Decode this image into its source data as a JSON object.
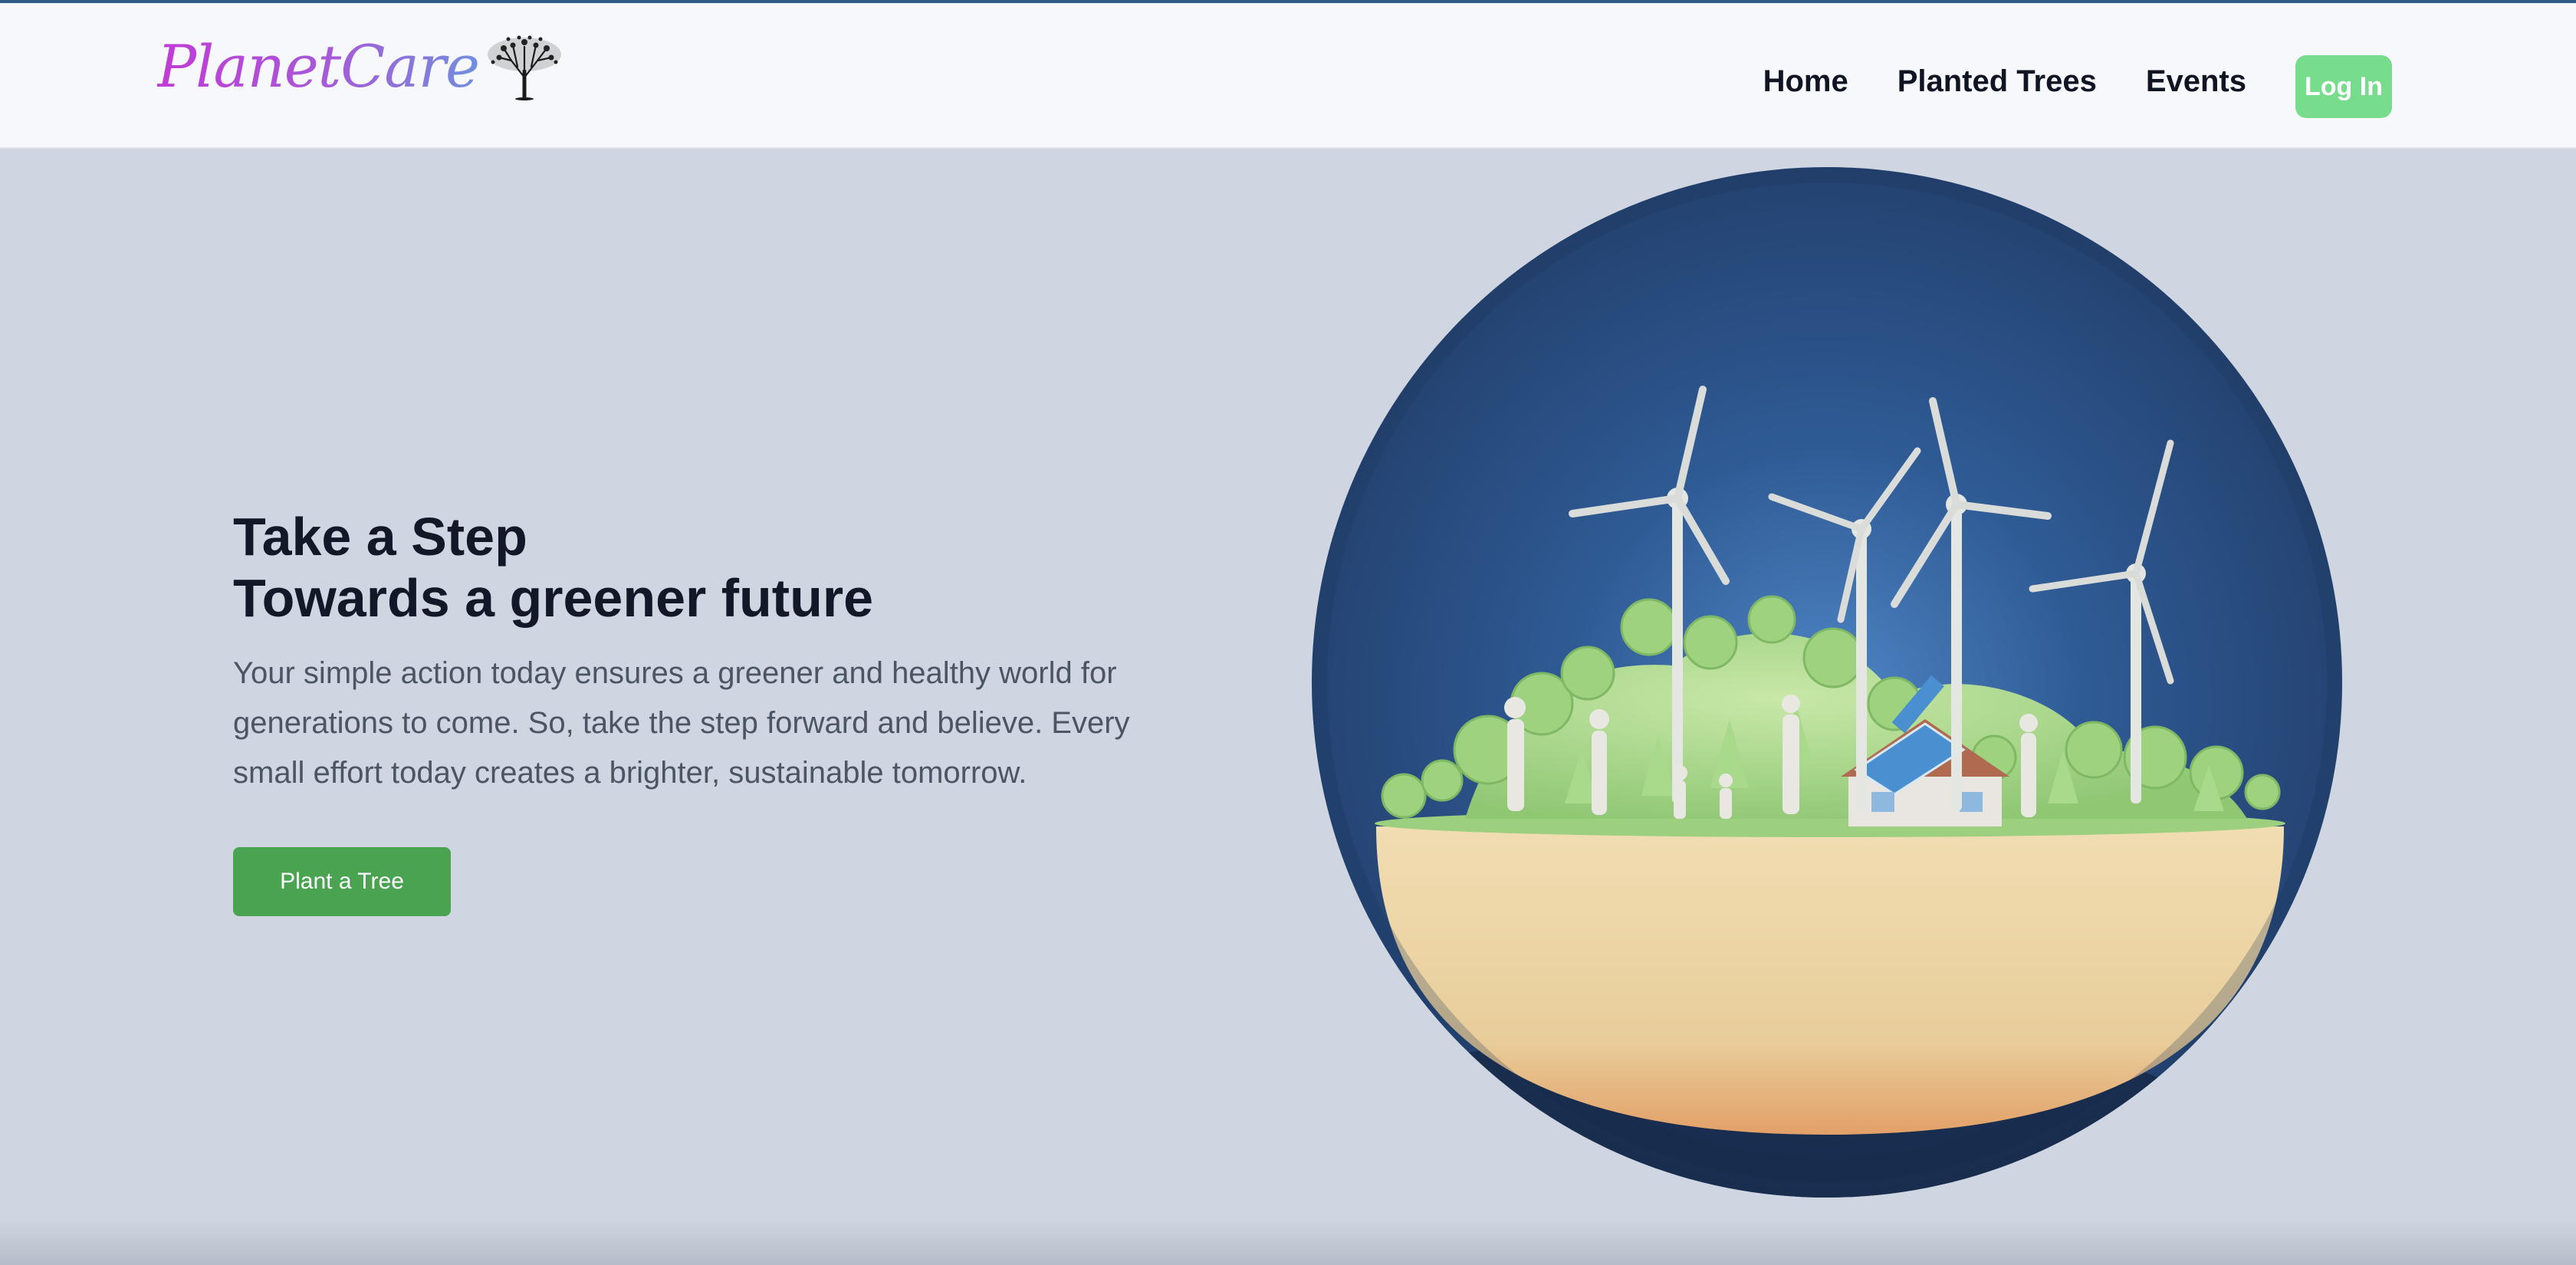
{
  "header": {
    "logo_text": "PlanetCare",
    "logo_icon": "tree-icon",
    "nav": [
      {
        "label": "Home"
      },
      {
        "label": "Planted Trees"
      },
      {
        "label": "Events"
      }
    ],
    "login_label": "Log In"
  },
  "hero": {
    "title_line1": "Take a Step",
    "title_line2": "Towards a greener future",
    "description": "Your simple action today ensures a greener and healthy world for generations to come. So, take the step forward and believe. Every small effort today creates a brighter, sustainable tomorrow.",
    "cta_label": "Plant a Tree",
    "illustration": "eco-globe-illustration"
  },
  "colors": {
    "background": "#cfd6e1",
    "header_bg": "#f7f8fb",
    "login_button": "#77dc8c",
    "cta_button": "#49a350",
    "globe_sky": "#2a4c7c",
    "logo_gradient": [
      "#c23ad6",
      "#6f8fe0"
    ]
  }
}
